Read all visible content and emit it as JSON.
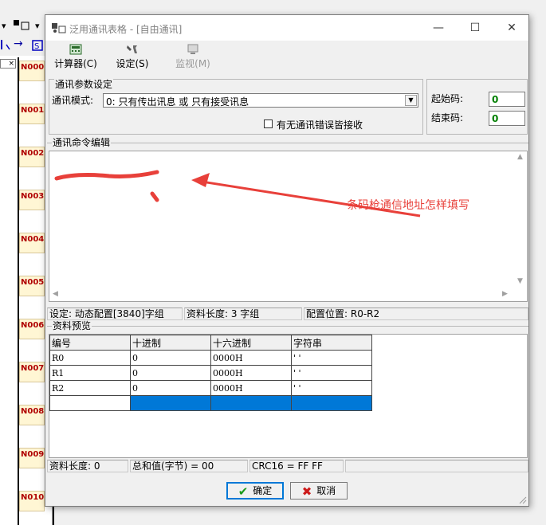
{
  "background": {
    "toolbar_symbols": [
      "▾",
      "▾",
      "→"
    ],
    "small_box_label": "×",
    "network_tags": [
      "N000",
      "N001",
      "N002",
      "N003",
      "N004",
      "N005",
      "N006",
      "N007",
      "N008",
      "N009",
      "N010"
    ]
  },
  "dialog": {
    "title": "泛用通讯表格 - [自由通讯]",
    "window_buttons": {
      "minimize": "—",
      "maximize": "☐",
      "close": "✕"
    },
    "toolbar": {
      "calculator": "计算器(C)",
      "settings": "设定(S)",
      "monitor": "监视(M)"
    },
    "comm_params": {
      "group_title": "通讯参数设定",
      "mode_label": "通讯模式:",
      "mode_value": "0: 只有传出讯息 或 只有接受讯息",
      "error_checkbox_label": "有无通讯错误皆接收",
      "error_checkbox_checked": false,
      "start_code_label": "起始码:",
      "start_code_value": "0",
      "end_code_label": "结束码:",
      "end_code_value": "0"
    },
    "command_editor": {
      "group_title": "通讯命令编辑"
    },
    "annotation": {
      "text": "条码枪通信地址怎样填写",
      "color": "#e8403a"
    },
    "edit_status": {
      "setting": "设定: 动态配置[3840]字组",
      "data_length": "资料长度: 3 字组",
      "config_position": "配置位置: R0-R2"
    },
    "data_preview": {
      "group_title": "资料预览",
      "headers": [
        "编号",
        "十进制",
        "十六进制",
        "字符串"
      ],
      "rows": [
        [
          "R0",
          "0",
          "0000H",
          "'  '"
        ],
        [
          "R1",
          "0",
          "0000H",
          "'  '"
        ],
        [
          "R2",
          "0",
          "0000H",
          "'  '"
        ]
      ]
    },
    "preview_status": {
      "length": "资料长度: 0",
      "sum": "总和值(字节) = 00",
      "crc": "CRC16 = FF FF"
    },
    "buttons": {
      "ok": "确定",
      "cancel": "取消"
    },
    "colors": {
      "selection": "#0078d7",
      "value_green": "#008000",
      "tag_red": "#b00000"
    }
  }
}
